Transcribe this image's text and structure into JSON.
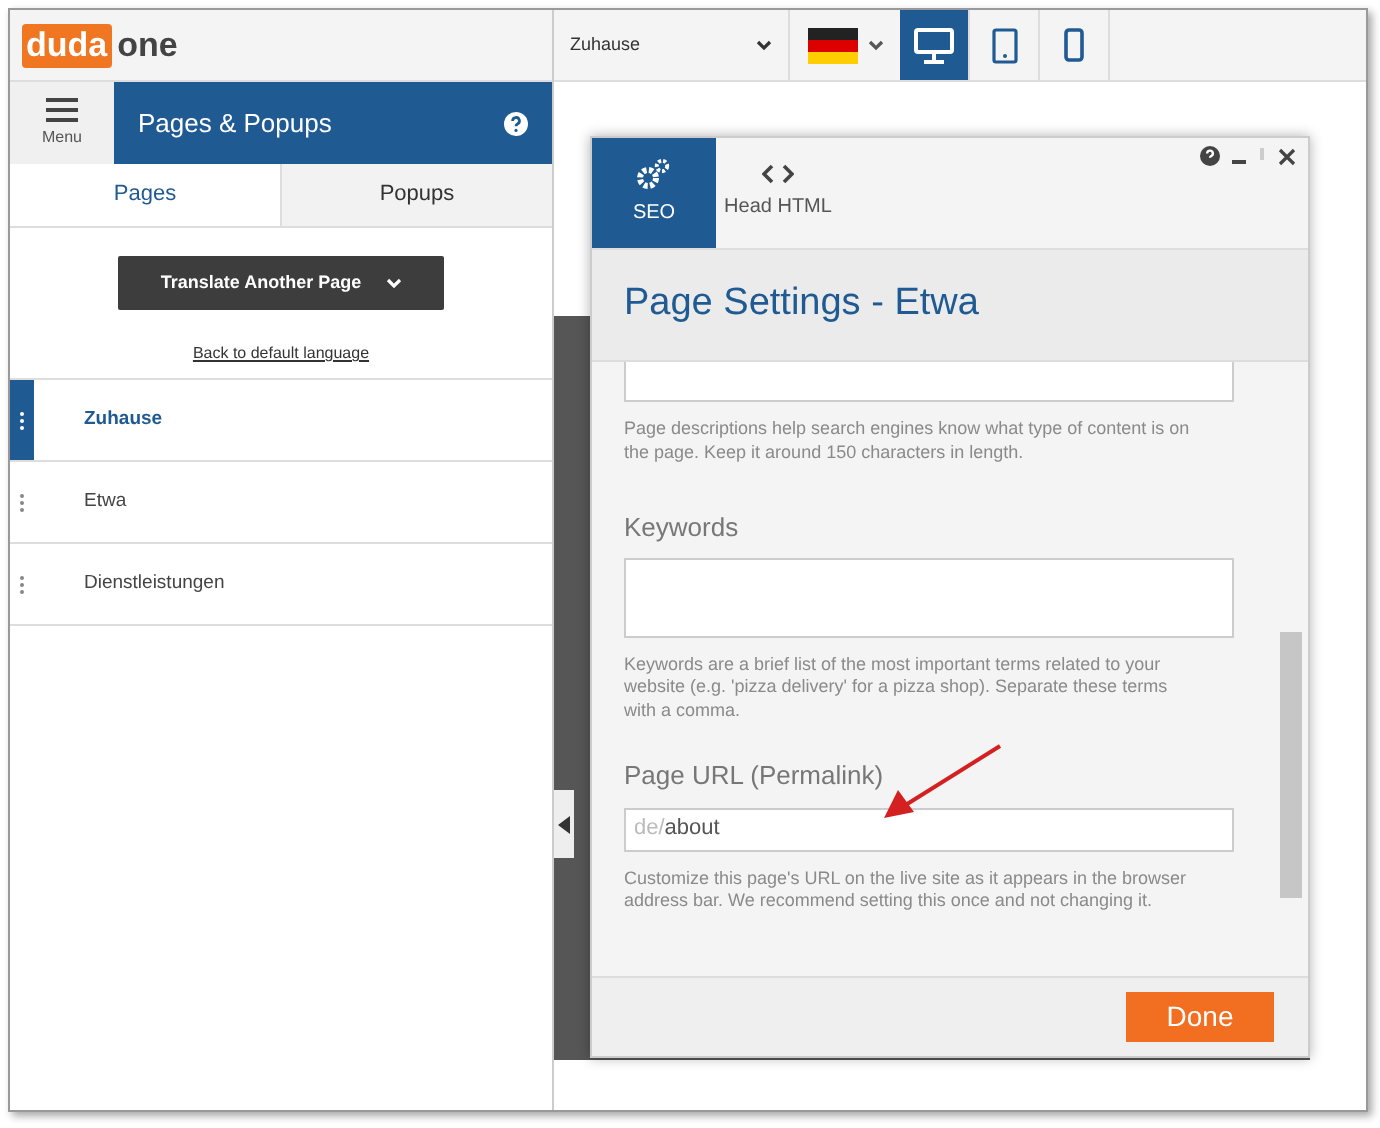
{
  "logo": {
    "brand": "duda",
    "suffix": "one"
  },
  "menu_button": {
    "label": "Menu"
  },
  "panel": {
    "title": "Pages & Popups"
  },
  "panel_tabs": [
    {
      "label": "Pages",
      "selected": true
    },
    {
      "label": "Popups",
      "selected": false
    }
  ],
  "translate_button": {
    "label": "Translate Another Page"
  },
  "back_link": "Back to default language",
  "pages": [
    {
      "label": "Zuhause",
      "selected": true
    },
    {
      "label": "Etwa",
      "selected": false
    },
    {
      "label": "Dienstleistungen",
      "selected": false
    }
  ],
  "toolbar": {
    "page_select": "Zuhause",
    "devices": [
      {
        "kind": "desktop",
        "selected": true
      },
      {
        "kind": "tablet",
        "selected": false
      },
      {
        "kind": "phone",
        "selected": false
      }
    ]
  },
  "dialog": {
    "tabs": [
      {
        "kind": "seo",
        "label": "SEO",
        "selected": true
      },
      {
        "kind": "html",
        "label": "Head HTML",
        "selected": false
      }
    ],
    "title": "Page Settings - Etwa",
    "description_help": "Page descriptions help search engines know what type of content is on the page. Keep it around 150 characters in length.",
    "keywords_label": "Keywords",
    "keywords_help": "Keywords are a brief list of the most important terms related to your website (e.g. 'pizza delivery' for a pizza shop). Separate these terms with a comma.",
    "url_label": "Page URL (Permalink)",
    "url_prefix": "de/",
    "url_value": "about",
    "url_help": "Customize this page's URL on the live site as it appears in the browser address bar. We recommend setting this once and not changing it.",
    "done_button": "Done"
  }
}
